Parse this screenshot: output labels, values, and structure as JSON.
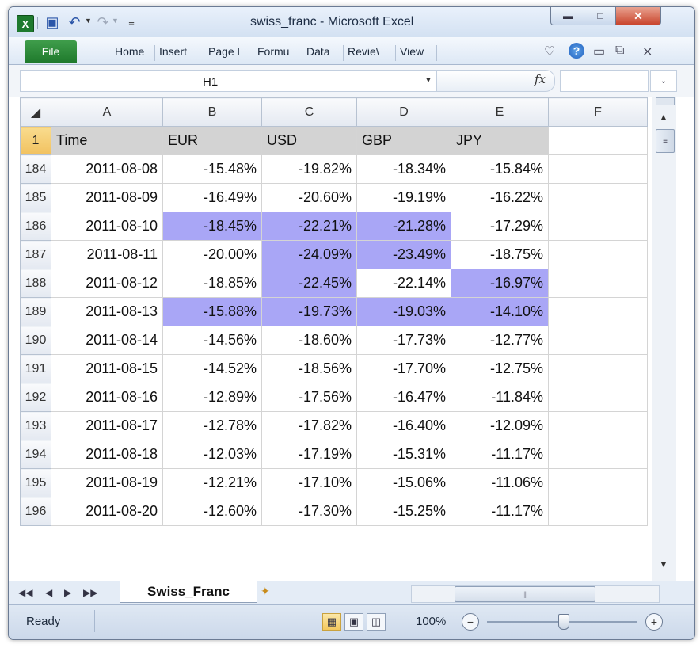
{
  "window": {
    "title": "swiss_franc - Microsoft Excel"
  },
  "ribbon": {
    "file_label": "File",
    "tabs": [
      "Home",
      "Insert",
      "Page l",
      "Formu",
      "Data",
      "Revie\\",
      "View"
    ]
  },
  "formula_bar": {
    "name_box": "H1",
    "fx_label": "fx",
    "formula": ""
  },
  "sheet": {
    "columns": [
      "A",
      "B",
      "C",
      "D",
      "E",
      "F"
    ],
    "header_row": {
      "row": "1",
      "cells": [
        "Time",
        "EUR",
        "USD",
        "GBP",
        "JPY",
        ""
      ]
    },
    "highlight_color": "#a9a6f6",
    "rows": [
      {
        "row": "184",
        "cells": [
          "2011-08-08",
          "-15.48%",
          "-19.82%",
          "-18.34%",
          "-15.84%",
          ""
        ],
        "hl": [
          false,
          false,
          false,
          false
        ]
      },
      {
        "row": "185",
        "cells": [
          "2011-08-09",
          "-16.49%",
          "-20.60%",
          "-19.19%",
          "-16.22%",
          ""
        ],
        "hl": [
          false,
          false,
          false,
          false
        ]
      },
      {
        "row": "186",
        "cells": [
          "2011-08-10",
          "-18.45%",
          "-22.21%",
          "-21.28%",
          "-17.29%",
          ""
        ],
        "hl": [
          true,
          true,
          true,
          false
        ]
      },
      {
        "row": "187",
        "cells": [
          "2011-08-11",
          "-20.00%",
          "-24.09%",
          "-23.49%",
          "-18.75%",
          ""
        ],
        "hl": [
          false,
          true,
          true,
          false
        ]
      },
      {
        "row": "188",
        "cells": [
          "2011-08-12",
          "-18.85%",
          "-22.45%",
          "-22.14%",
          "-16.97%",
          ""
        ],
        "hl": [
          false,
          true,
          false,
          true
        ]
      },
      {
        "row": "189",
        "cells": [
          "2011-08-13",
          "-15.88%",
          "-19.73%",
          "-19.03%",
          "-14.10%",
          ""
        ],
        "hl": [
          true,
          true,
          true,
          true
        ]
      },
      {
        "row": "190",
        "cells": [
          "2011-08-14",
          "-14.56%",
          "-18.60%",
          "-17.73%",
          "-12.77%",
          ""
        ],
        "hl": [
          false,
          false,
          false,
          false
        ]
      },
      {
        "row": "191",
        "cells": [
          "2011-08-15",
          "-14.52%",
          "-18.56%",
          "-17.70%",
          "-12.75%",
          ""
        ],
        "hl": [
          false,
          false,
          false,
          false
        ]
      },
      {
        "row": "192",
        "cells": [
          "2011-08-16",
          "-12.89%",
          "-17.56%",
          "-16.47%",
          "-11.84%",
          ""
        ],
        "hl": [
          false,
          false,
          false,
          false
        ]
      },
      {
        "row": "193",
        "cells": [
          "2011-08-17",
          "-12.78%",
          "-17.82%",
          "-16.40%",
          "-12.09%",
          ""
        ],
        "hl": [
          false,
          false,
          false,
          false
        ]
      },
      {
        "row": "194",
        "cells": [
          "2011-08-18",
          "-12.03%",
          "-17.19%",
          "-15.31%",
          "-11.17%",
          ""
        ],
        "hl": [
          false,
          false,
          false,
          false
        ]
      },
      {
        "row": "195",
        "cells": [
          "2011-08-19",
          "-12.21%",
          "-17.10%",
          "-15.06%",
          "-11.06%",
          ""
        ],
        "hl": [
          false,
          false,
          false,
          false
        ]
      },
      {
        "row": "196",
        "cells": [
          "2011-08-20",
          "-12.60%",
          "-17.30%",
          "-15.25%",
          "-11.17%",
          ""
        ],
        "hl": [
          false,
          false,
          false,
          false
        ]
      }
    ],
    "sheet_tab": "Swiss_Franc"
  },
  "status": {
    "text": "Ready",
    "zoom": "100%"
  }
}
